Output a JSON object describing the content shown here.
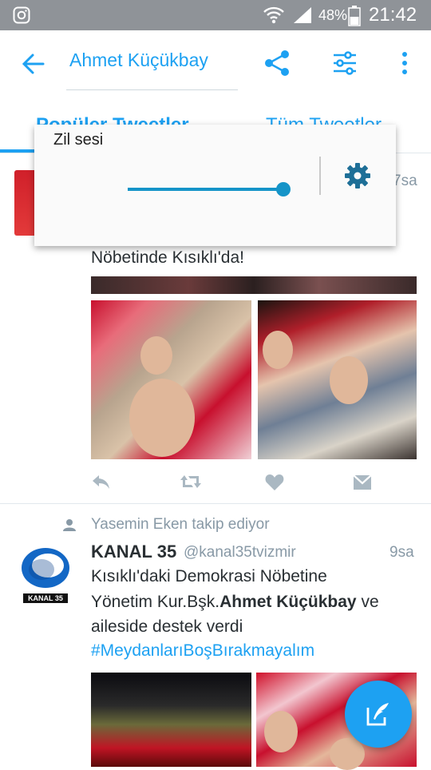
{
  "status_bar": {
    "battery_percent": "48%",
    "time": "21:42",
    "icons": [
      "instagram-icon",
      "wifi-icon",
      "signal-icon",
      "battery-icon"
    ]
  },
  "header": {
    "title": "Ahmet Küçükbay",
    "icons": [
      "back-arrow-icon",
      "share-icon",
      "filter-icon",
      "more-vert-icon"
    ]
  },
  "tabs": [
    {
      "label": "Popüler Tweetler",
      "active": true
    },
    {
      "label": "Tüm Tweetler",
      "active": false
    }
  ],
  "volume_popup": {
    "label": "Zil sesi",
    "level": 1.0,
    "icon": "gear-icon"
  },
  "tweet1": {
    "time": "7sa",
    "text": "Nöbetinde Kısıklı'da!",
    "actions": [
      "reply-icon",
      "retweet-icon",
      "like-icon",
      "dm-icon"
    ]
  },
  "tweet2": {
    "follow_context": "Yasemin Eken takip ediyor",
    "name": "KANAL 35",
    "handle": "@kanal35tvizmir",
    "time": "9sa",
    "text_line1": "Kısıklı'daki Demokrasi Nöbetine",
    "text_line2_prefix": "Yönetim Kur.Bşk.",
    "text_line2_bold": "Ahmet Küçükbay",
    "text_line2_suffix": " ve",
    "text_line3": "aileside destek verdi",
    "hashtag": "#MeydanlarıBoşBırakmayalım",
    "avatar_label": "KANAL 35"
  },
  "colors": {
    "accent": "#1da1f2",
    "status_bar": "#8f9398",
    "muted": "#8899a6",
    "slider": "#1594c8"
  },
  "fab": {
    "icon": "compose-icon"
  }
}
